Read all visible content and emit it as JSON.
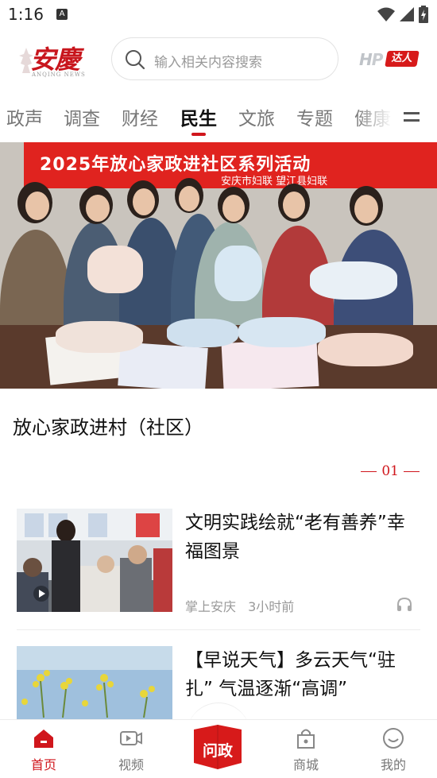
{
  "status_bar": {
    "time": "1:16",
    "sim_letter": "A"
  },
  "header": {
    "logo_text": "安慶",
    "logo_subtext": "ANQING NEWS",
    "search_placeholder": "输入相关内容搜索",
    "hot_badge_prefix": "H",
    "hot_badge_label": "达人"
  },
  "tabs": [
    {
      "label": "政声",
      "active": false
    },
    {
      "label": "调查",
      "active": false
    },
    {
      "label": "财经",
      "active": false
    },
    {
      "label": "民生",
      "active": true
    },
    {
      "label": "文旅",
      "active": false
    },
    {
      "label": "专题",
      "active": false
    },
    {
      "label": "健康",
      "active": false
    }
  ],
  "hero": {
    "banner_text": "2025年放心家政进社区系列活动",
    "banner_sub": "安庆市妇联    望江县妇联",
    "headline": "放心家政进村（社区）",
    "page_number": "01"
  },
  "news": [
    {
      "title": "文明实践绘就“老有善养”幸福图景",
      "source": "掌上安庆",
      "time": "3小时前",
      "has_video": true
    },
    {
      "title": "【早说天气】多云天气“驻扎” 气温逐渐“高调”",
      "source": "",
      "time": "",
      "has_video": false
    }
  ],
  "bottom_nav": [
    {
      "label": "首页",
      "icon": "home-icon",
      "active": true
    },
    {
      "label": "视频",
      "icon": "video-icon",
      "active": false
    },
    {
      "label": "问政",
      "icon": "wenzheng-icon",
      "active": false
    },
    {
      "label": "商城",
      "icon": "shop-icon",
      "active": false
    },
    {
      "label": "我的",
      "icon": "profile-icon",
      "active": false
    }
  ],
  "colors": {
    "brand_red": "#d0161c",
    "muted_text": "#999999",
    "tab_inactive": "#777777"
  }
}
